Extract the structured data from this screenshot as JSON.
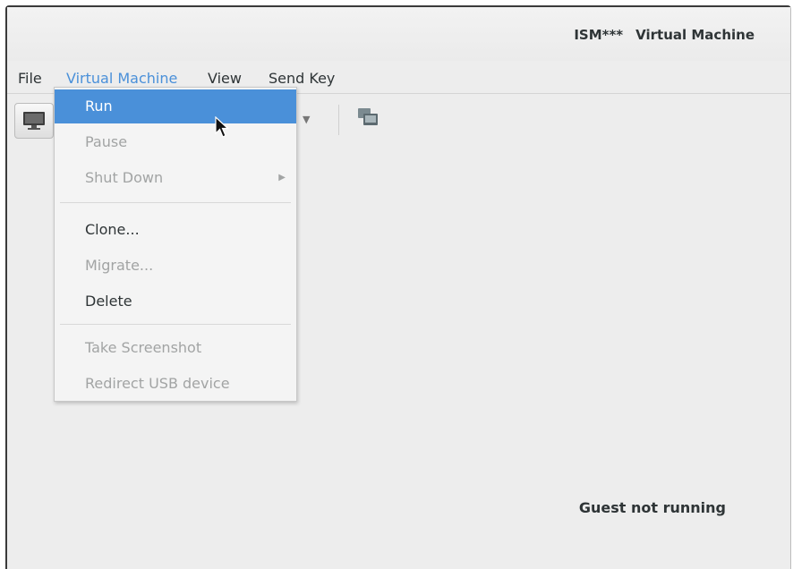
{
  "window": {
    "title_host": "ISM***",
    "title_name": "Virtual Machine"
  },
  "menubar": {
    "items": [
      "File",
      "Virtual Machine",
      "View",
      "Send Key"
    ],
    "active": "Virtual Machine"
  },
  "toolbar": {
    "icons": [
      "monitor-icon",
      "dropdown-arrow-icon",
      "screenshot-icon"
    ]
  },
  "dropdown": {
    "items": [
      {
        "label": "Run",
        "enabled": true,
        "highlighted": true
      },
      {
        "label": "Pause",
        "enabled": false
      },
      {
        "label": "Shut Down",
        "enabled": false,
        "submenu": true
      },
      {
        "label": "Clone...",
        "enabled": true
      },
      {
        "label": "Migrate...",
        "enabled": false
      },
      {
        "label": "Delete",
        "enabled": true
      },
      {
        "label": "Take Screenshot",
        "enabled": false
      },
      {
        "label": "Redirect USB device",
        "enabled": false
      }
    ]
  },
  "status": {
    "text": "Guest not running"
  },
  "colors": {
    "accent": "#4a90d9",
    "background": "#ededed",
    "disabled_text": "#a2a4a4"
  }
}
